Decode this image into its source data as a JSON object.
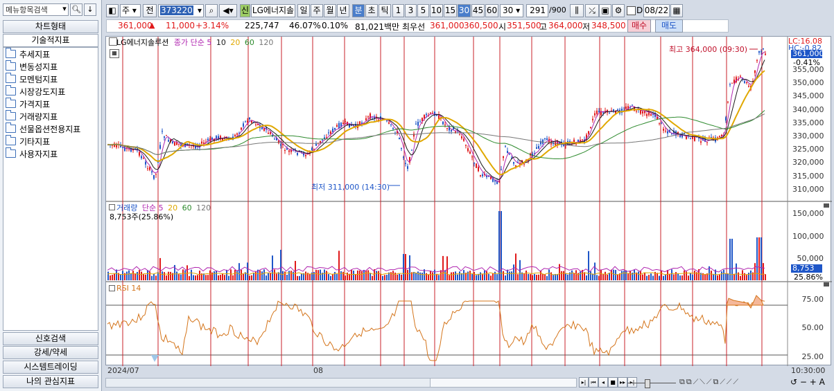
{
  "left_panel": {
    "search_placeholder": "메뉴항목검색",
    "tabs": [
      "차트형태",
      "기술적지표"
    ],
    "tree": [
      "추세지표",
      "변동성지표",
      "모멘텀지표",
      "시장강도지표",
      "가격지표",
      "거래량지표",
      "선물옵션전용지표",
      "기타지표",
      "사용자지표"
    ],
    "bottom_tabs": [
      "신호검색",
      "강세/약세",
      "시스템트레이딩",
      "나의 관심지표"
    ]
  },
  "toolbar": {
    "period_select": "주",
    "jeon": "전",
    "code": "373220",
    "shin_badge": "신",
    "stock_name": "LG에너지솔",
    "period_buttons": [
      "일",
      "주",
      "월",
      "년",
      "분",
      "초",
      "틱"
    ],
    "active_period": "분",
    "minute_buttons": [
      "1",
      "3",
      "5",
      "10",
      "15",
      "30",
      "45",
      "60"
    ],
    "active_minute": "30",
    "minute_select": "30",
    "count": "291",
    "count_total": "/900",
    "d_label": "D",
    "date": "08/22"
  },
  "info": {
    "price": "361,000",
    "change_arrow": "▲",
    "change": "11,000",
    "change_pct": "+3.14%",
    "volume": "225,747",
    "ratio1": "46.07%",
    "ratio2": "0.10%",
    "amount": "81,021백만",
    "best_label": "최우선",
    "best_ask": "361,000",
    "best_bid": "360,500",
    "open_label": "시",
    "open": "351,500",
    "high_label": "고",
    "high": "364,000",
    "low_label": "저",
    "low": "348,500",
    "buy": "매수",
    "sell": "매도"
  },
  "price_panel": {
    "legend_name": "LG에너지솔루션",
    "legend_ma": "종가 단순",
    "ma_periods": [
      "5",
      "10",
      "20",
      "60",
      "120"
    ],
    "annotation_high": "최고 364,000 (09:30)",
    "annotation_low": "최저 311,000 (14:30)",
    "lc": "LC:16.08",
    "hc": "HC:-0.82",
    "current_badge": "361,000",
    "current_change": "-0.41%",
    "y_ticks": [
      "355,000",
      "350,000",
      "345,000",
      "340,000",
      "335,000",
      "330,000",
      "325,000",
      "320,000",
      "315,000",
      "310,000"
    ]
  },
  "volume_panel": {
    "legend_name": "거래량",
    "legend_ma": "단순",
    "ma_periods": [
      "5",
      "20",
      "60",
      "120"
    ],
    "value_text": "8,753주(25.86%)",
    "badge": "8,753",
    "badge_pct": "25.86%",
    "y_ticks": [
      "150,000",
      "100,000",
      "50,000"
    ]
  },
  "rsi_panel": {
    "legend": "RSI 14",
    "y_ticks": [
      "75.00",
      "50.00",
      "25.00"
    ]
  },
  "x_axis": {
    "start": "2024/07",
    "mid": "08",
    "time": "10:30:00"
  },
  "colors": {
    "up": "#e0191a",
    "down": "#1e56c8",
    "ma5": "#1a1a1a",
    "ma20": "#e0a800",
    "ma60": "#2d8a2d",
    "ma120": "#777777",
    "rsi": "#d4741a",
    "accent": "#4a7ecb"
  }
}
